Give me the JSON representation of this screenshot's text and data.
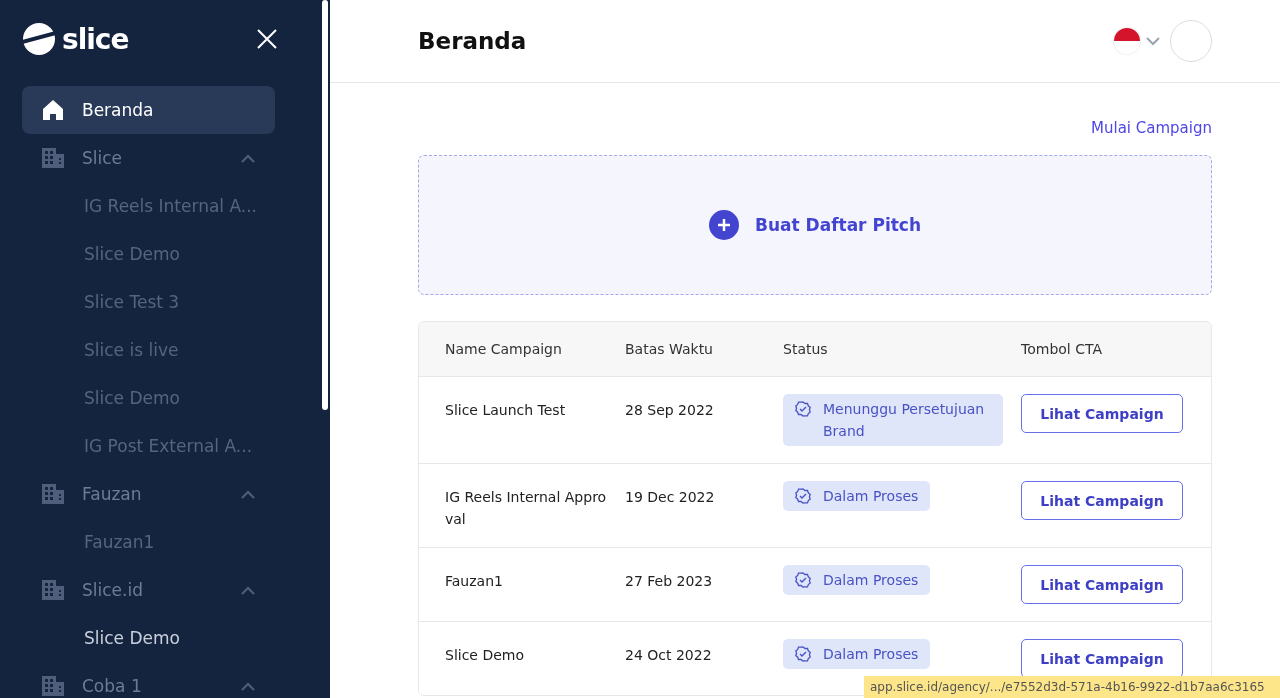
{
  "sidebar": {
    "logo": "slice",
    "nav": [
      {
        "kind": "home",
        "label": "Beranda",
        "selected": true
      },
      {
        "kind": "group",
        "label": "Slice",
        "expanded": true,
        "selected": false,
        "children": [
          {
            "label": "IG Reels Internal A...",
            "selected": false
          },
          {
            "label": "Slice Demo",
            "selected": false
          },
          {
            "label": "Slice Test 3",
            "selected": false
          },
          {
            "label": "Slice is live",
            "selected": false
          },
          {
            "label": "Slice Demo",
            "selected": false
          },
          {
            "label": "IG Post External A...",
            "selected": false
          }
        ]
      },
      {
        "kind": "group",
        "label": "Fauzan",
        "expanded": true,
        "selected": false,
        "children": [
          {
            "label": "Fauzan1",
            "selected": false
          }
        ]
      },
      {
        "kind": "group",
        "label": "Slice.id",
        "expanded": true,
        "selected": false,
        "children": [
          {
            "label": "Slice Demo",
            "selected": true
          }
        ]
      },
      {
        "kind": "group",
        "label": "Coba 1",
        "expanded": true,
        "selected": false
      }
    ]
  },
  "header": {
    "title": "Beranda"
  },
  "start_link": "Mulai Campaign",
  "pitch": {
    "label": "Buat Daftar Pitch"
  },
  "table": {
    "columns": [
      "Name Campaign",
      "Batas Waktu",
      "Status",
      "Tombol CTA"
    ],
    "rows": [
      {
        "name": "Slice Launch Test",
        "deadline": "28 Sep 2022",
        "status": "Menunggu Persetujuan Brand",
        "cta": "Lihat Campaign"
      },
      {
        "name": "IG Reels Internal Approval",
        "deadline": "19 Dec 2022",
        "status": "Dalam Proses",
        "cta": "Lihat Campaign"
      },
      {
        "name": "Fauzan1",
        "deadline": "27 Feb 2023",
        "status": "Dalam Proses",
        "cta": "Lihat Campaign"
      },
      {
        "name": "Slice Demo",
        "deadline": "24 Oct 2022",
        "status": "Dalam Proses",
        "cta": "Lihat Campaign"
      }
    ]
  },
  "status_bar": {
    "url": "app.slice.id/agency/.../e7552d3d-571a-4b16-9922-d1b7aa6c3165"
  }
}
